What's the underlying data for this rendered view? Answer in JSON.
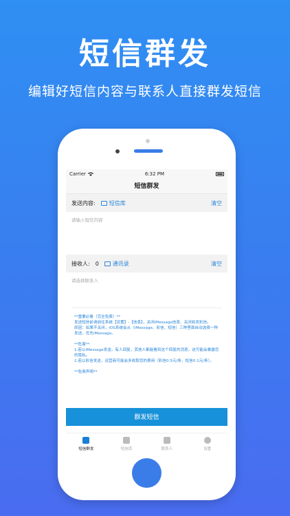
{
  "promo": {
    "title": "短信群发",
    "subtitle": "编辑好短信内容与联系人直接群发短信"
  },
  "status_bar": {
    "carrier": "Carrier",
    "time": "6:32 PM"
  },
  "nav": {
    "title": "短信群发"
  },
  "content_row": {
    "label": "发送内容:",
    "library_link": "短信库",
    "clear": "清空"
  },
  "message_input": {
    "placeholder": "请输入短信内容"
  },
  "recipient_row": {
    "label": "接收人:",
    "count": "0",
    "contacts_link": "通讯录",
    "clear": "清空"
  },
  "recipient_input": {
    "placeholder": "请选择联系人"
  },
  "notes": {
    "block1": "**重要必看（完全免费）**\n发送短信前请前往系统【设置】-【信息】，关闭iMessage信息、关闭收发彩信。\n原因：如果不关闭，iOS系统会从（iMessage、彩信、短信）三种里面自动选择一种发送，优先iMessage。",
    "block2": "**危害**\n1.若以iMessage发送，有人回复，其他人都能看到这个回复的消息，这可能会暴露您的隐私。\n2.若以彩信发送，运营商可能会多收取您的费用（彩信0.5元/条，短信0.1元/条）。",
    "block3": "**免责声明**"
  },
  "send_button": {
    "label": "群发短信"
  },
  "tabs": [
    {
      "label": "短信群发",
      "icon": "home-icon",
      "active": true
    },
    {
      "label": "短信库",
      "icon": "envelope-icon",
      "active": false
    },
    {
      "label": "联系人",
      "icon": "contacts-icon",
      "active": false
    },
    {
      "label": "设置",
      "icon": "gear-icon",
      "active": false
    }
  ]
}
